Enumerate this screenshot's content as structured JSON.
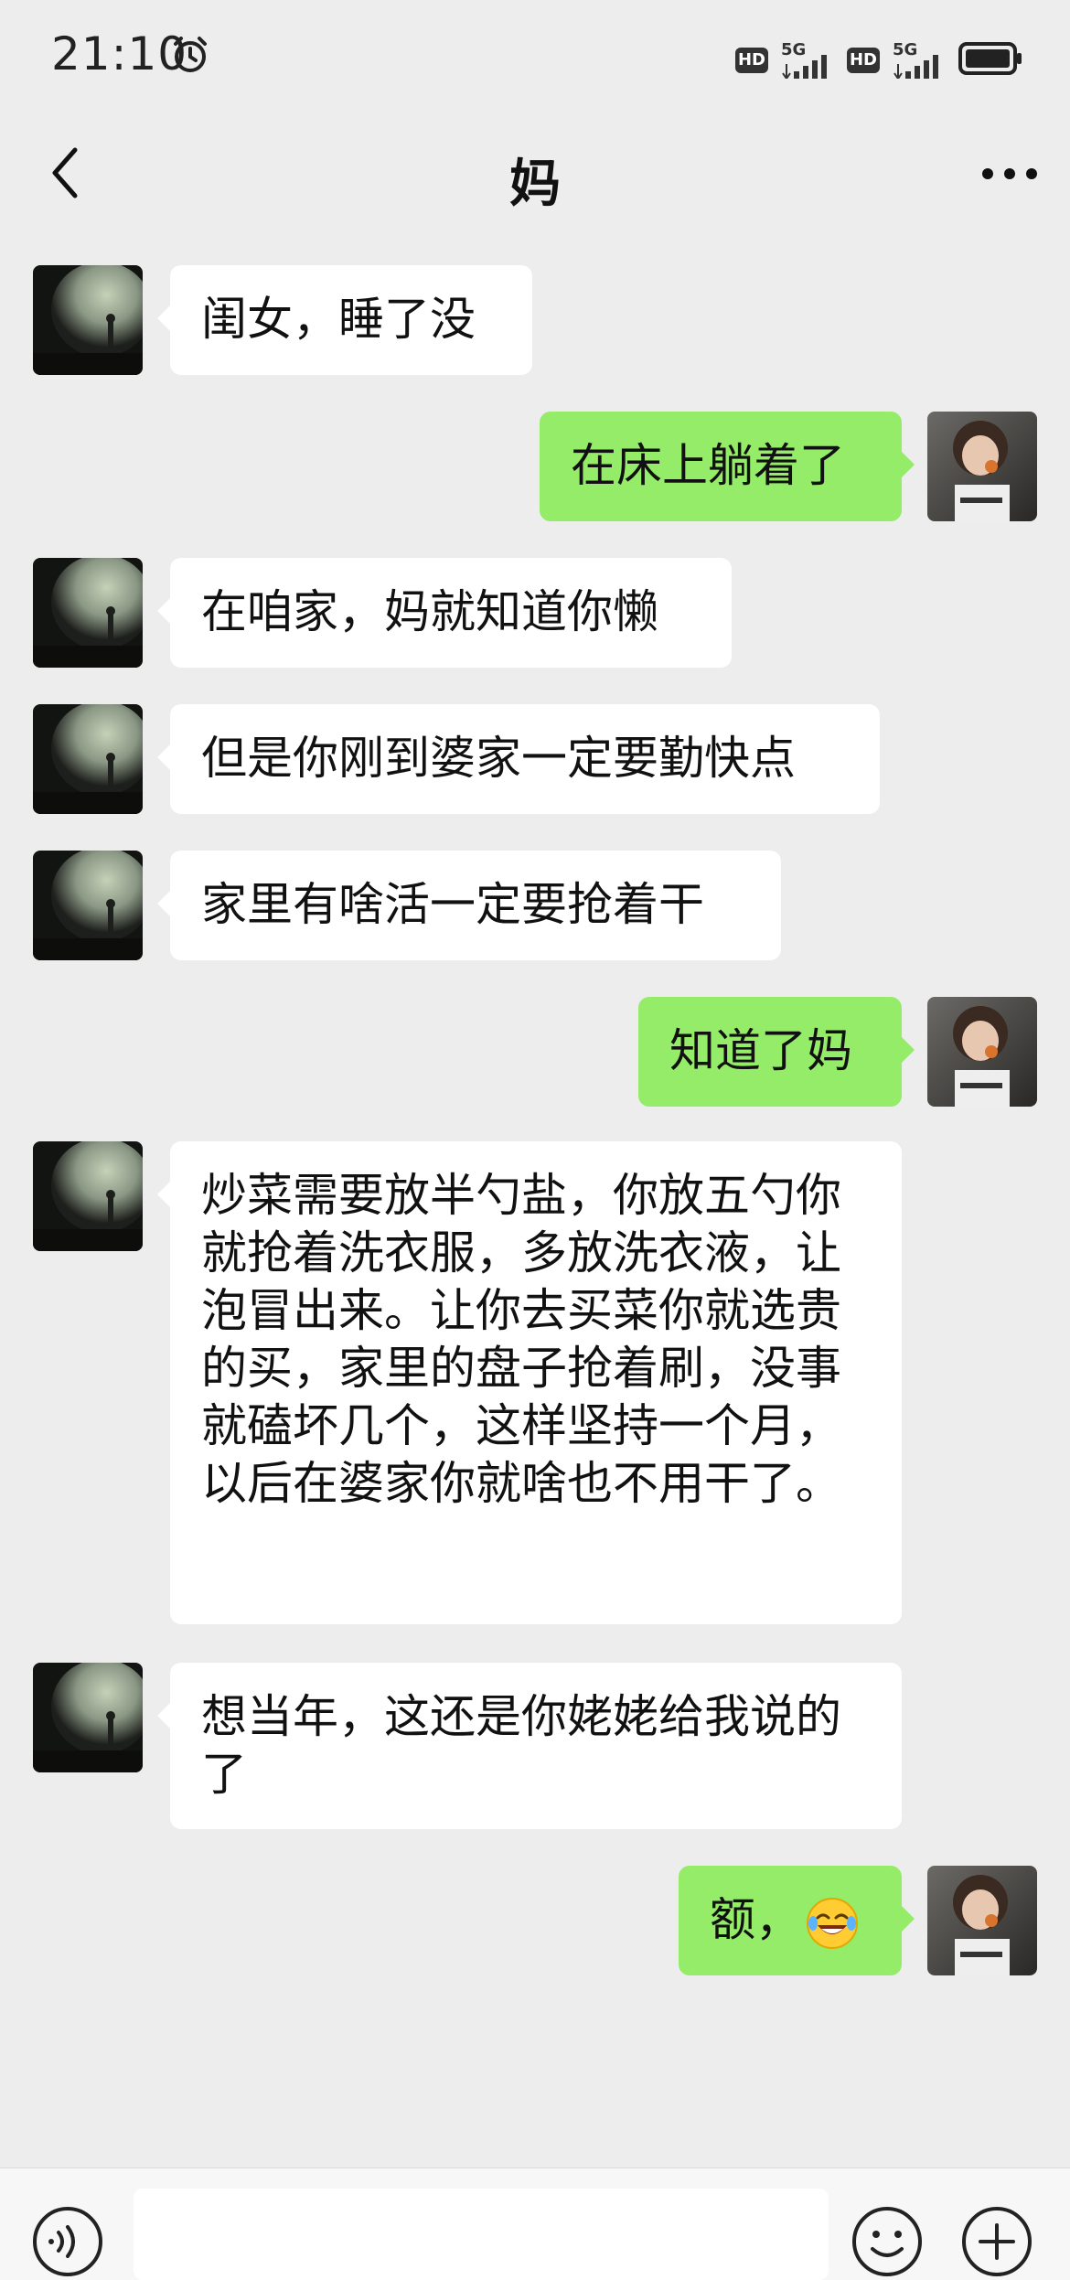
{
  "status_bar": {
    "time": "21:10",
    "network_1": {
      "hd": "HD",
      "type": "5G"
    },
    "network_2": {
      "hd": "HD",
      "type": "5G"
    }
  },
  "header": {
    "title": "妈"
  },
  "colors": {
    "background": "#ededed",
    "incoming_bubble": "#ffffff",
    "outgoing_bubble": "#95ec69"
  },
  "messages": [
    {
      "from": "mom",
      "text": "闺女，睡了没"
    },
    {
      "from": "me",
      "text": "在床上躺着了"
    },
    {
      "from": "mom",
      "text": "在咱家，妈就知道你懒"
    },
    {
      "from": "mom",
      "text": "但是你刚到婆家一定要勤快点"
    },
    {
      "from": "mom",
      "text": "家里有啥活一定要抢着干"
    },
    {
      "from": "me",
      "text": "知道了妈"
    },
    {
      "from": "mom",
      "text": "炒菜需要放半勺盐，你放五勺你就抢着洗衣服，多放洗衣液，让泡冒出来。让你去买菜你就选贵的买，家里的盘子抢着刷，没事就磕坏几个，这样坚持一个月，以后在婆家你就啥也不用干了。"
    },
    {
      "from": "mom",
      "text": "想当年，这还是你姥姥给我说的了"
    },
    {
      "from": "me",
      "text": "额，",
      "emoji": "face-with-tears-of-joy-icon"
    }
  ]
}
